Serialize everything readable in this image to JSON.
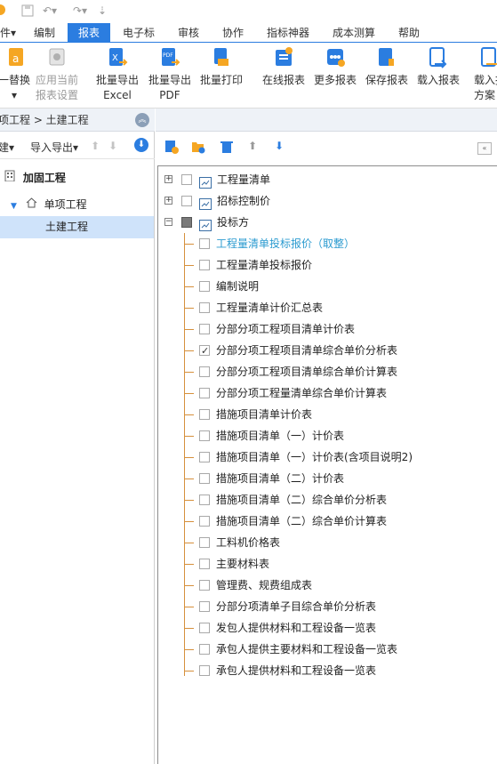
{
  "menus": [
    "件▾",
    "编制",
    "报表",
    "电子标",
    "审核",
    "协作",
    "指标神器",
    "成本测算",
    "帮助"
  ],
  "ribbon": {
    "replace": "一替换",
    "apply_current": [
      "应用当前",
      "报表设置"
    ],
    "batch_excel": [
      "批量导出",
      "Excel"
    ],
    "batch_pdf": [
      "批量导出",
      "PDF"
    ],
    "batch_print": "批量打印",
    "online_report": "在线报表",
    "more_report": "更多报表",
    "save_report": "保存报表",
    "load_report": "载入报表",
    "load_scheme": [
      "载入报",
      "方案"
    ]
  },
  "left": {
    "breadcrumb": "项工程 > 土建工程",
    "new_label": "建▾",
    "import_export": "导入导出▾",
    "tree": {
      "root": "加固工程",
      "child": "单项工程",
      "leaf": "土建工程"
    }
  },
  "right": {
    "groups": [
      {
        "label": "工程量清单"
      },
      {
        "label": "招标控制价"
      },
      {
        "label": "投标方"
      }
    ],
    "reports": [
      {
        "label": "工程量清单投标报价（取整）",
        "highlight": true,
        "checked": false
      },
      {
        "label": "工程量清单投标报价",
        "checked": false
      },
      {
        "label": "编制说明",
        "checked": false
      },
      {
        "label": "工程量清单计价汇总表",
        "checked": false
      },
      {
        "label": "分部分项工程项目清单计价表",
        "checked": false
      },
      {
        "label": "分部分项工程项目清单综合单价分析表",
        "checked": true
      },
      {
        "label": "分部分项工程项目清单综合单价计算表",
        "checked": false
      },
      {
        "label": "分部分项工程量清单综合单价计算表",
        "checked": false
      },
      {
        "label": "措施项目清单计价表",
        "checked": false
      },
      {
        "label": "措施项目清单（一）计价表",
        "checked": false
      },
      {
        "label": "措施项目清单（一）计价表(含项目说明2)",
        "checked": false
      },
      {
        "label": "措施项目清单（二）计价表",
        "checked": false
      },
      {
        "label": "措施项目清单（二）综合单价分析表",
        "checked": false
      },
      {
        "label": "措施项目清单（二）综合单价计算表",
        "checked": false
      },
      {
        "label": "工料机价格表",
        "checked": false
      },
      {
        "label": "主要材料表",
        "checked": false
      },
      {
        "label": "管理费、规费组成表",
        "checked": false
      },
      {
        "label": "分部分项清单子目综合单价分析表",
        "checked": false
      },
      {
        "label": "发包人提供材料和工程设备一览表",
        "checked": false
      },
      {
        "label": "承包人提供主要材料和工程设备一览表",
        "checked": false
      },
      {
        "label": "承包人提供材料和工程设备一览表",
        "checked": false
      }
    ]
  },
  "colors": {
    "accent": "#2b7de0",
    "highlight_text": "#2b9bd0",
    "tree_line": "#d6903c",
    "selected_bg": "#cfe3fa"
  }
}
